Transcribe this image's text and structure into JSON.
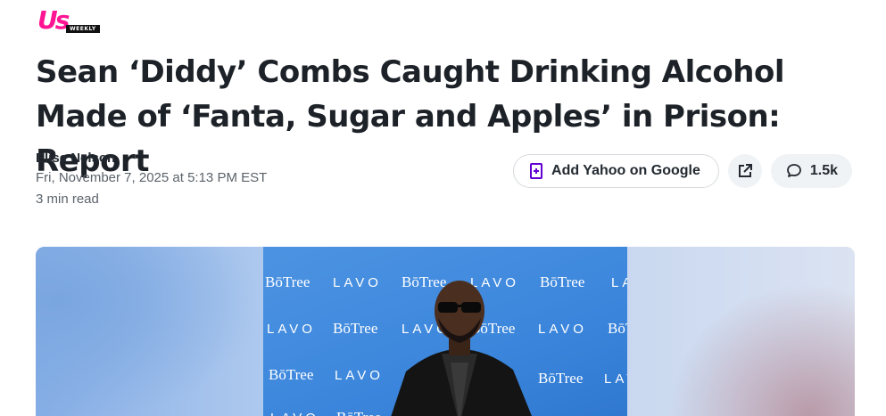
{
  "brand": {
    "logo_main": "Us",
    "logo_sub": "WEEKLY",
    "accent": "#ff1493"
  },
  "article": {
    "headline": "Sean ‘Diddy’ Combs Caught Drinking Alcohol Made of ‘Fanta, Sugar and Apples’ in Prison: Report",
    "author": "Elise Nelson",
    "date": "Fri, November 7, 2025 at 5:13 PM EST",
    "read_time": "3 min read"
  },
  "actions": {
    "add_google_label": "Add Yahoo on Google",
    "add_google_icon": "add-document-icon",
    "share_icon": "share-external-icon",
    "comment_icon": "comment-bubble-icon",
    "comment_count": "1.5k",
    "accent": "#6001d2"
  },
  "photo": {
    "backdrop_words": [
      "BōTree",
      "LAVO"
    ]
  }
}
